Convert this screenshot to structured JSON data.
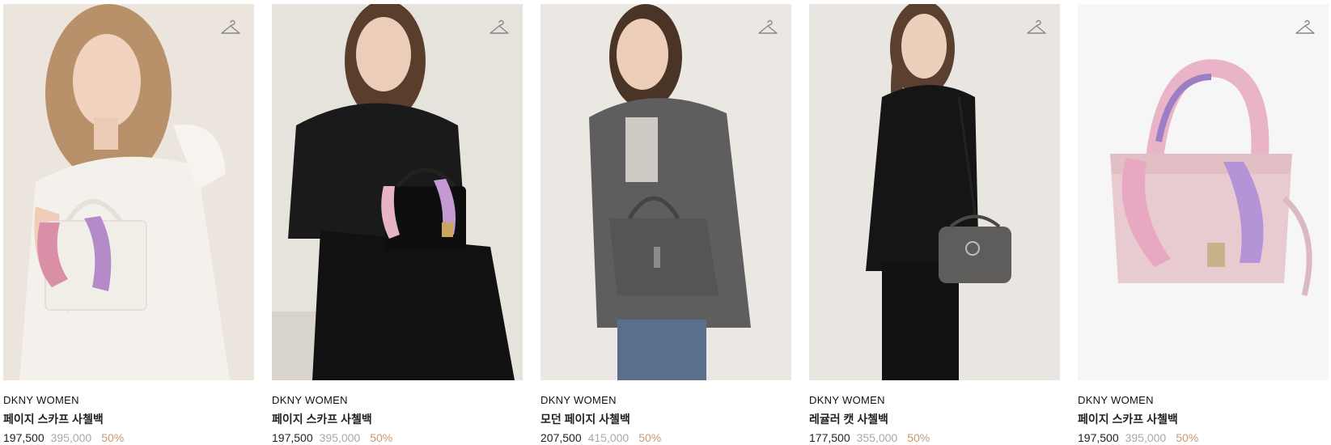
{
  "products": [
    {
      "brand": "DKNY WOMEN",
      "name": "페이지 스카프 사첼백",
      "price": "197,500",
      "original_price": "395,000",
      "discount": "50%"
    },
    {
      "brand": "DKNY WOMEN",
      "name": "페이지 스카프 사첼백",
      "price": "197,500",
      "original_price": "395,000",
      "discount": "50%"
    },
    {
      "brand": "DKNY WOMEN",
      "name": "모던 페이지 사첼백",
      "price": "207,500",
      "original_price": "415,000",
      "discount": "50%"
    },
    {
      "brand": "DKNY WOMEN",
      "name": "레귤러 캣 사첼백",
      "price": "177,500",
      "original_price": "355,000",
      "discount": "50%"
    },
    {
      "brand": "DKNY WOMEN",
      "name": "페이지 스카프 사첼백",
      "price": "197,500",
      "original_price": "395,000",
      "discount": "50%"
    }
  ],
  "icons": {
    "wishlist": "hanger-icon"
  },
  "colors": {
    "discount": "#c99a72",
    "original_price": "#a8a8a8",
    "text": "#222222"
  }
}
